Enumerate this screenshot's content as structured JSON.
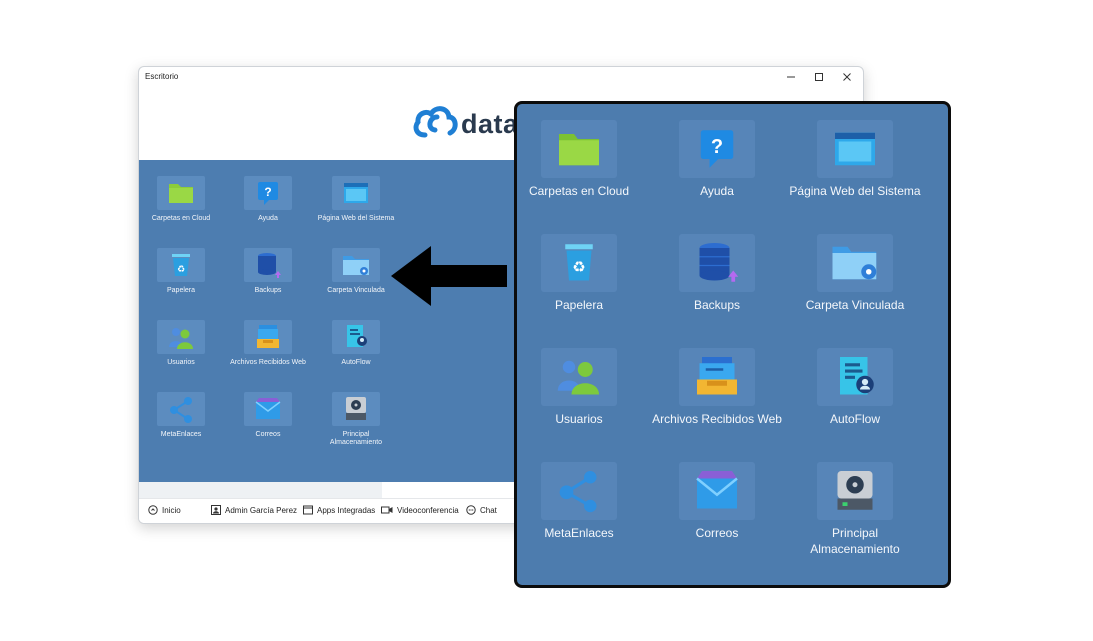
{
  "window": {
    "title": "Escritorio",
    "logo_text": "data"
  },
  "apps": [
    {
      "id": "carpetas",
      "label": "Carpetas en Cloud",
      "icon": "folder-icon"
    },
    {
      "id": "ayuda",
      "label": "Ayuda",
      "icon": "help-icon"
    },
    {
      "id": "pagina",
      "label": "Página Web del Sistema",
      "icon": "browser-window-icon"
    },
    {
      "id": "papelera",
      "label": "Papelera",
      "icon": "recycle-bin-icon"
    },
    {
      "id": "backups",
      "label": "Backups",
      "icon": "database-icon"
    },
    {
      "id": "vinculada",
      "label": "Carpeta Vinculada",
      "icon": "folder-gear-icon"
    },
    {
      "id": "usuarios",
      "label": "Usuarios",
      "icon": "users-icon"
    },
    {
      "id": "archivos",
      "label": "Archivos Recibidos Web",
      "icon": "inbox-tray-icon"
    },
    {
      "id": "autoflow",
      "label": "AutoFlow",
      "icon": "document-user-icon"
    },
    {
      "id": "metaenlaces",
      "label": "MetaEnlaces",
      "icon": "share-nodes-icon"
    },
    {
      "id": "correos",
      "label": "Correos",
      "icon": "mail-envelope-icon"
    },
    {
      "id": "almacenamiento",
      "label": "Principal Almacenamiento",
      "icon": "hard-drive-icon"
    }
  ],
  "taskbar": {
    "inicio": "Inicio",
    "user": "Admin García Perez",
    "apps": "Apps Integradas",
    "video": "Videoconferencia",
    "chat": "Chat"
  },
  "colors": {
    "desktop": "#4d7db0",
    "panel": "#4d7cae",
    "tile": "#5785b8"
  }
}
